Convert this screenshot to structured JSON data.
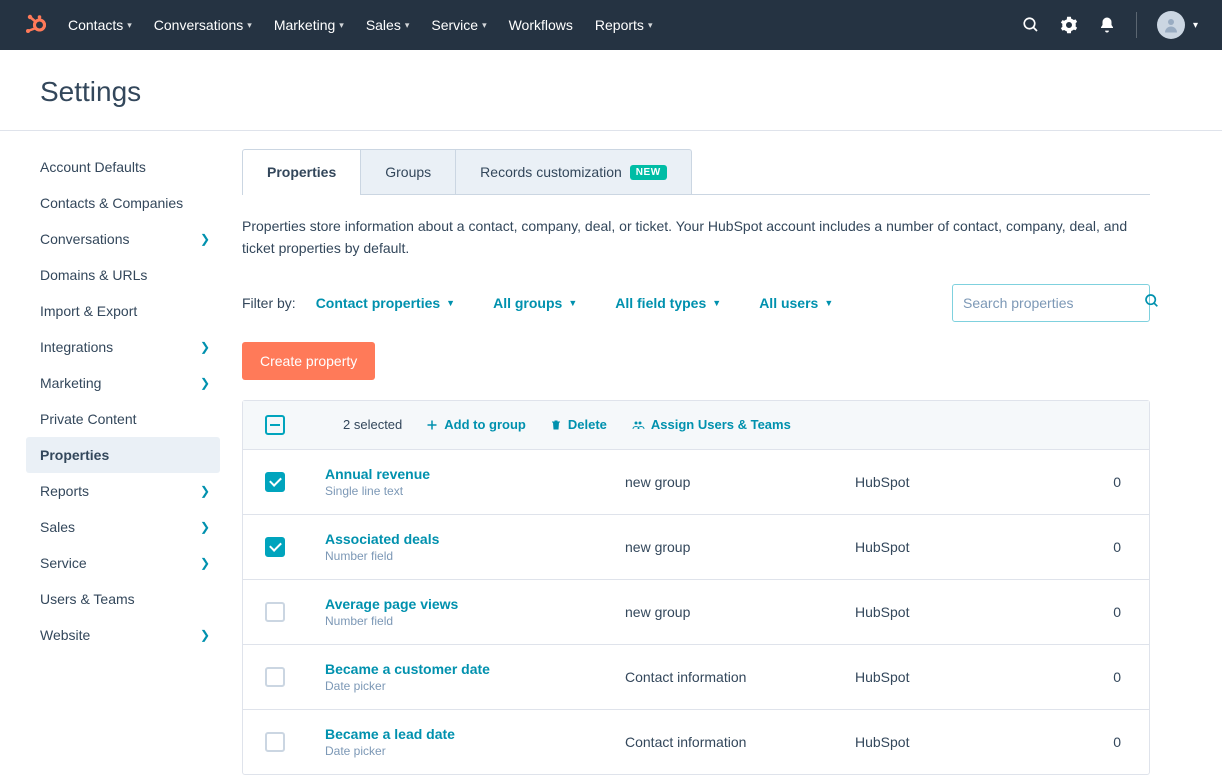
{
  "nav": {
    "items": [
      "Contacts",
      "Conversations",
      "Marketing",
      "Sales",
      "Service",
      "Workflows",
      "Reports"
    ],
    "no_dropdown": [
      5
    ]
  },
  "page_title": "Settings",
  "sidebar": {
    "items": [
      {
        "label": "Account Defaults",
        "expandable": false
      },
      {
        "label": "Contacts & Companies",
        "expandable": false
      },
      {
        "label": "Conversations",
        "expandable": true
      },
      {
        "label": "Domains & URLs",
        "expandable": false
      },
      {
        "label": "Import & Export",
        "expandable": false
      },
      {
        "label": "Integrations",
        "expandable": true
      },
      {
        "label": "Marketing",
        "expandable": true
      },
      {
        "label": "Private Content",
        "expandable": false
      },
      {
        "label": "Properties",
        "expandable": false,
        "active": true
      },
      {
        "label": "Reports",
        "expandable": true
      },
      {
        "label": "Sales",
        "expandable": true
      },
      {
        "label": "Service",
        "expandable": true
      },
      {
        "label": "Users & Teams",
        "expandable": false
      },
      {
        "label": "Website",
        "expandable": true
      }
    ]
  },
  "tabs": [
    {
      "label": "Properties",
      "active": true
    },
    {
      "label": "Groups"
    },
    {
      "label": "Records customization",
      "badge": "NEW"
    }
  ],
  "description": "Properties store information about a contact, company, deal, or ticket. Your HubSpot account includes a number of contact, company, deal, and ticket properties by default.",
  "filters": {
    "label": "Filter by:",
    "items": [
      "Contact properties",
      "All groups",
      "All field types",
      "All users"
    ]
  },
  "search_placeholder": "Search properties",
  "create_btn": "Create property",
  "toolbar": {
    "selected": "2 selected",
    "add": "Add to group",
    "delete": "Delete",
    "assign": "Assign Users & Teams"
  },
  "rows": [
    {
      "checked": true,
      "name": "Annual revenue",
      "type": "Single line text",
      "group": "new group",
      "created": "HubSpot",
      "count": "0"
    },
    {
      "checked": true,
      "name": "Associated deals",
      "type": "Number field",
      "group": "new group",
      "created": "HubSpot",
      "count": "0"
    },
    {
      "checked": false,
      "name": "Average page views",
      "type": "Number field",
      "group": "new group",
      "created": "HubSpot",
      "count": "0"
    },
    {
      "checked": false,
      "name": "Became a customer date",
      "type": "Date picker",
      "group": "Contact information",
      "created": "HubSpot",
      "count": "0"
    },
    {
      "checked": false,
      "name": "Became a lead date",
      "type": "Date picker",
      "group": "Contact information",
      "created": "HubSpot",
      "count": "0"
    }
  ]
}
